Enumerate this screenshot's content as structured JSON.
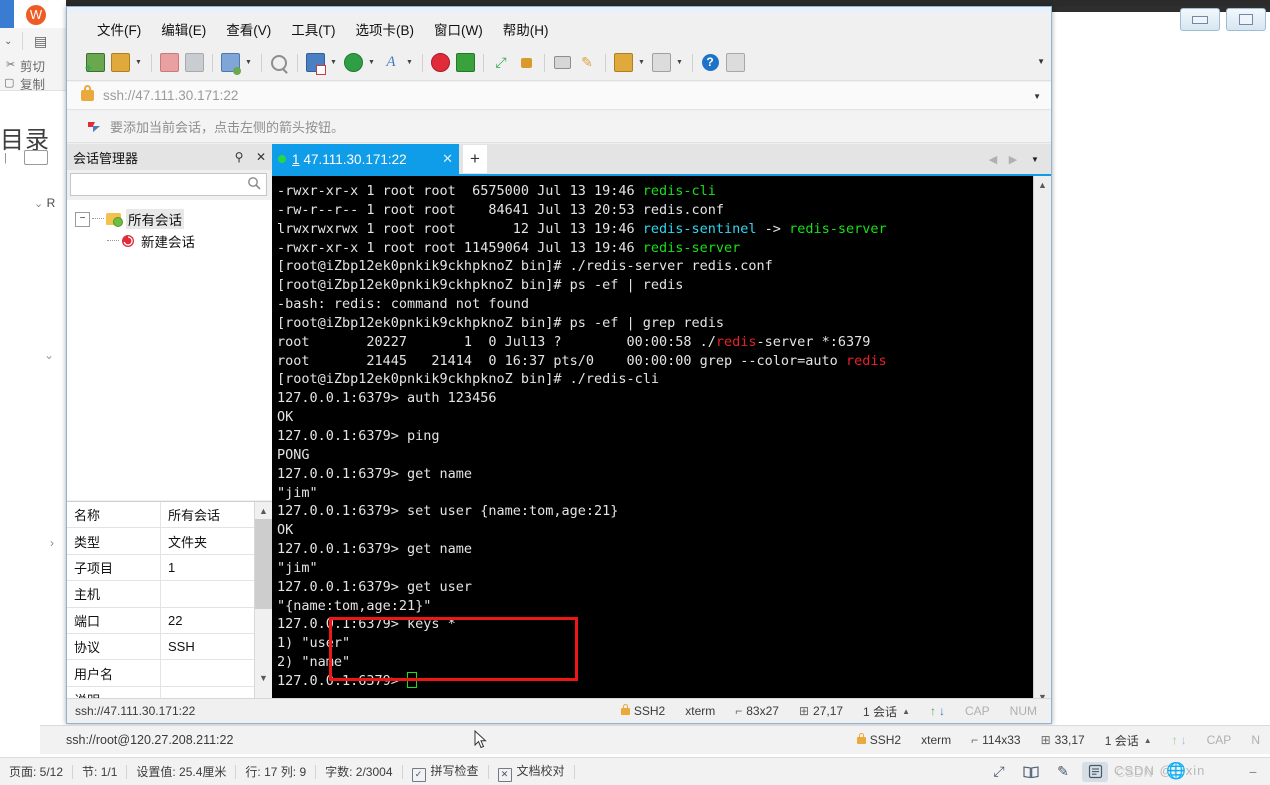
{
  "background_app": {
    "name": "WPS Office Document",
    "ribbon_labels": [
      "剪切",
      "复制"
    ],
    "outline_label": "目录",
    "nav_label": "R",
    "status_bar": {
      "items": [
        "页面: 5/12",
        "节: 1/1",
        "设置值: 25.4厘米",
        "行: 17   列: 9",
        "字数: 2/3004"
      ],
      "spell_check": "拼写检查",
      "doc_proof": "文档校对",
      "right_icons": [
        {
          "name": "fullscreen-icon",
          "glyph": "⤢"
        },
        {
          "name": "read-mode-icon",
          "glyph": "▭"
        },
        {
          "name": "highlight-pen-icon",
          "glyph": "✎"
        },
        {
          "name": "page-layout-icon",
          "glyph": "▤"
        }
      ],
      "watermark": "CSDN @Lixin",
      "watermark2": "CSDN"
    }
  },
  "xshell": {
    "menubar": [
      {
        "label": "文件(F)",
        "name": "menu-file"
      },
      {
        "label": "编辑(E)",
        "name": "menu-edit"
      },
      {
        "label": "查看(V)",
        "name": "menu-view"
      },
      {
        "label": "工具(T)",
        "name": "menu-tools"
      },
      {
        "label": "选项卡(B)",
        "name": "menu-tabs"
      },
      {
        "label": "窗口(W)",
        "name": "menu-window"
      },
      {
        "label": "帮助(H)",
        "name": "menu-help"
      }
    ],
    "toolbar": [
      {
        "name": "new-session-icon",
        "glyph": "▣",
        "color": "#4caf50",
        "caret": false
      },
      {
        "name": "open-folder-icon",
        "glyph": "📁",
        "color": "#d9a23a",
        "caret": true
      },
      {
        "name": "disconnect-icon",
        "glyph": "✂",
        "color": "#d96a6a",
        "caret": false
      },
      {
        "name": "reconnect-icon",
        "glyph": "🔗",
        "color": "#9aa0a6",
        "caret": false
      },
      {
        "name": "session-properties-icon",
        "glyph": "▦",
        "color": "#5b8fd0",
        "caret": true
      },
      {
        "name": "find-icon",
        "glyph": "🔍",
        "color": "#8a8a8a",
        "caret": false
      },
      {
        "name": "file-transfer-icon",
        "glyph": "⇄",
        "color": "#3d7ac4",
        "caret": true
      },
      {
        "name": "globe-icon",
        "glyph": "🌐",
        "color": "#2f9e44",
        "caret": true
      },
      {
        "name": "font-icon",
        "glyph": "A",
        "color": "#3f7fc1",
        "caret": true
      },
      {
        "name": "xshell-icon",
        "glyph": "◉",
        "color": "#e02b3a",
        "caret": false
      },
      {
        "name": "xftp-icon",
        "glyph": "◧",
        "color": "#39a23c",
        "caret": false
      },
      {
        "name": "fullscreen-icon",
        "glyph": "⤢",
        "color": "#2fa84f",
        "caret": false
      },
      {
        "name": "lock-icon",
        "glyph": "🔒",
        "color": "#d99a2b",
        "caret": false
      },
      {
        "name": "keyboard-icon",
        "glyph": "⌨",
        "color": "#8a8a8a",
        "caret": false
      },
      {
        "name": "highlight-icon",
        "glyph": "✎",
        "color": "#d9a23a",
        "caret": false
      },
      {
        "name": "save-log-icon",
        "glyph": "🖫",
        "color": "#d9a23a",
        "caret": true
      },
      {
        "name": "layout-icon",
        "glyph": "▥",
        "color": "#9aa0a6",
        "caret": true
      },
      {
        "name": "help-icon",
        "glyph": "?",
        "color": "#1e73c8",
        "caret": false
      },
      {
        "name": "comment-icon",
        "glyph": "🗨",
        "color": "#9aa0a6",
        "caret": false
      }
    ],
    "address_bar": {
      "value": "ssh://47.111.30.171:22",
      "lock_icon": "lock-icon"
    },
    "hint_bar": {
      "text": "要添加当前会话，点击左侧的箭头按钮。",
      "icon": "red-flag-icon"
    },
    "session_manager": {
      "title": "会话管理器",
      "pin_label": "⚲",
      "close_label": "✕",
      "search_placeholder": "",
      "search_icon": "search-icon",
      "tree": {
        "root": "所有会话",
        "child": "新建会话"
      },
      "properties": [
        {
          "key": "名称",
          "value": "所有会话"
        },
        {
          "key": "类型",
          "value": "文件夹"
        },
        {
          "key": "子项目",
          "value": "1"
        },
        {
          "key": "主机",
          "value": ""
        },
        {
          "key": "端口",
          "value": "22"
        },
        {
          "key": "协议",
          "value": "SSH"
        },
        {
          "key": "用户名",
          "value": ""
        },
        {
          "key": "说明",
          "value": ""
        }
      ]
    },
    "tabs": {
      "active": {
        "number": "1",
        "title": "47.111.30.171:22",
        "close": "✕"
      },
      "add_label": "+",
      "nav_prev": "◀",
      "nav_next": "▶",
      "menu": "▼"
    },
    "terminal": {
      "lines": [
        [
          {
            "t": "-rwxr-xr-x 1 root root  6575000 Jul 13 19:46 ",
            "c": "w"
          },
          {
            "t": "redis-cli",
            "c": "g"
          }
        ],
        [
          {
            "t": "-rw-r--r-- 1 root root    84641 Jul 13 20:53 redis.conf",
            "c": "w"
          }
        ],
        [
          {
            "t": "lrwxrwxrwx 1 root root       12 Jul 13 19:46 ",
            "c": "w"
          },
          {
            "t": "redis-sentinel",
            "c": "c"
          },
          {
            "t": " -> ",
            "c": "w"
          },
          {
            "t": "redis-server",
            "c": "g"
          }
        ],
        [
          {
            "t": "-rwxr-xr-x 1 root root 11459064 Jul 13 19:46 ",
            "c": "w"
          },
          {
            "t": "redis-server",
            "c": "g"
          }
        ],
        [
          {
            "t": "[root@iZbp12ek0pnkik9ckhpknoZ bin]# ./redis-server redis.conf",
            "c": "w"
          }
        ],
        [
          {
            "t": "[root@iZbp12ek0pnkik9ckhpknoZ bin]# ps -ef | redis",
            "c": "w"
          }
        ],
        [
          {
            "t": "-bash: redis: command not found",
            "c": "w"
          }
        ],
        [
          {
            "t": "[root@iZbp12ek0pnkik9ckhpknoZ bin]# ps -ef | grep redis",
            "c": "w"
          }
        ],
        [
          {
            "t": "root       20227       1  0 Jul13 ?        00:00:58 ./",
            "c": "w"
          },
          {
            "t": "redis",
            "c": "r"
          },
          {
            "t": "-server *:6379",
            "c": "w"
          }
        ],
        [
          {
            "t": "root       21445   21414  0 16:37 pts/0    00:00:00 grep --color=auto ",
            "c": "w"
          },
          {
            "t": "redis",
            "c": "r"
          }
        ],
        [
          {
            "t": "[root@iZbp12ek0pnkik9ckhpknoZ bin]# ./redis-cli",
            "c": "w"
          }
        ],
        [
          {
            "t": "127.0.0.1:6379> auth 123456",
            "c": "w"
          }
        ],
        [
          {
            "t": "OK",
            "c": "w"
          }
        ],
        [
          {
            "t": "127.0.0.1:6379> ping",
            "c": "w"
          }
        ],
        [
          {
            "t": "PONG",
            "c": "w"
          }
        ],
        [
          {
            "t": "127.0.0.1:6379> get name",
            "c": "w"
          }
        ],
        [
          {
            "t": "\"jim\"",
            "c": "w"
          }
        ],
        [
          {
            "t": "127.0.0.1:6379> set user {name:tom,age:21}",
            "c": "w"
          }
        ],
        [
          {
            "t": "OK",
            "c": "w"
          }
        ],
        [
          {
            "t": "127.0.0.1:6379> get name",
            "c": "w"
          }
        ],
        [
          {
            "t": "\"jim\"",
            "c": "w"
          }
        ],
        [
          {
            "t": "127.0.0.1:6379> get user",
            "c": "w"
          }
        ],
        [
          {
            "t": "\"{name:tom,age:21}\"",
            "c": "w"
          }
        ],
        [
          {
            "t": "127.0.0.1:6379> keys *",
            "c": "w"
          }
        ],
        [
          {
            "t": "1) \"user\"",
            "c": "w"
          }
        ],
        [
          {
            "t": "2) \"name\"",
            "c": "w"
          }
        ],
        [
          {
            "t": "127.0.0.1:6379> ",
            "c": "w"
          }
        ]
      ],
      "highlight_box_color": "#ef1616"
    },
    "status_bar": {
      "left": "ssh://47.111.30.171:22",
      "protocol": "SSH2",
      "term_type": "xterm",
      "size": "83x27",
      "cursor": "27,17",
      "sessions": "1 会话",
      "cap": "CAP",
      "num": "NUM"
    }
  },
  "outer_status_bar": {
    "left": "ssh://root@120.27.208.211:22",
    "protocol": "SSH2",
    "term_type": "xterm",
    "size": "114x33",
    "cursor": "33,17",
    "sessions": "1 会话",
    "cap": "CAP",
    "num": "N"
  }
}
